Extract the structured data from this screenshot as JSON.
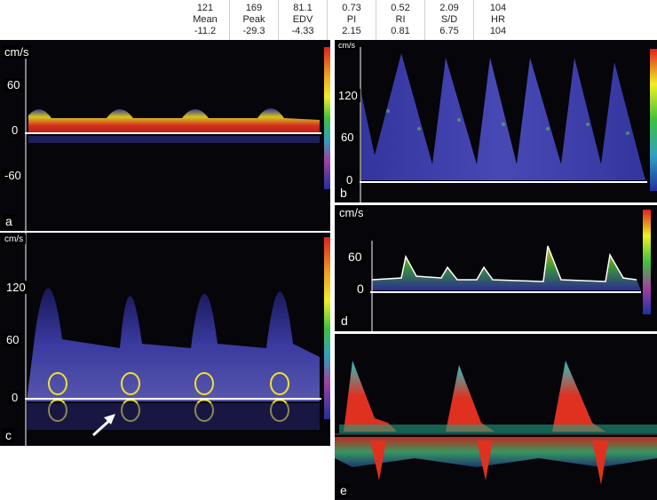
{
  "header_stats": [
    {
      "top": "121",
      "name": "Mean",
      "bottom": "-11.2"
    },
    {
      "top": "169",
      "name": "Peak",
      "bottom": "-29.3"
    },
    {
      "top": "81.1",
      "name": "EDV",
      "bottom": "-4.33"
    },
    {
      "top": "0.73",
      "name": "PI",
      "bottom": "2.15"
    },
    {
      "top": "0.52",
      "name": "RI",
      "bottom": "0.81"
    },
    {
      "top": "2.09",
      "name": "S/D",
      "bottom": "6.75"
    },
    {
      "top": "104",
      "name": "HR",
      "bottom": "104"
    }
  ],
  "panels": {
    "a": {
      "label": "a",
      "unit": "cm/s",
      "ticks": [
        "60",
        "0",
        "-60"
      ]
    },
    "b": {
      "label": "b",
      "unit": "cm/s",
      "ticks": [
        "120",
        "60",
        "0"
      ]
    },
    "c": {
      "label": "c",
      "unit": "cm/s",
      "ticks": [
        "120",
        "60",
        "0"
      ]
    },
    "d": {
      "label": "d",
      "unit": "cm/s",
      "ticks": [
        "60",
        "0"
      ]
    },
    "e": {
      "label": "e"
    }
  },
  "colors": {
    "background": "#05050a",
    "spectrum_low": "#2a2a9a",
    "spectrum_mid": "#e0d020",
    "spectrum_high": "#e03020",
    "baseline": "#ffffff",
    "arrow": "#ffffff"
  }
}
